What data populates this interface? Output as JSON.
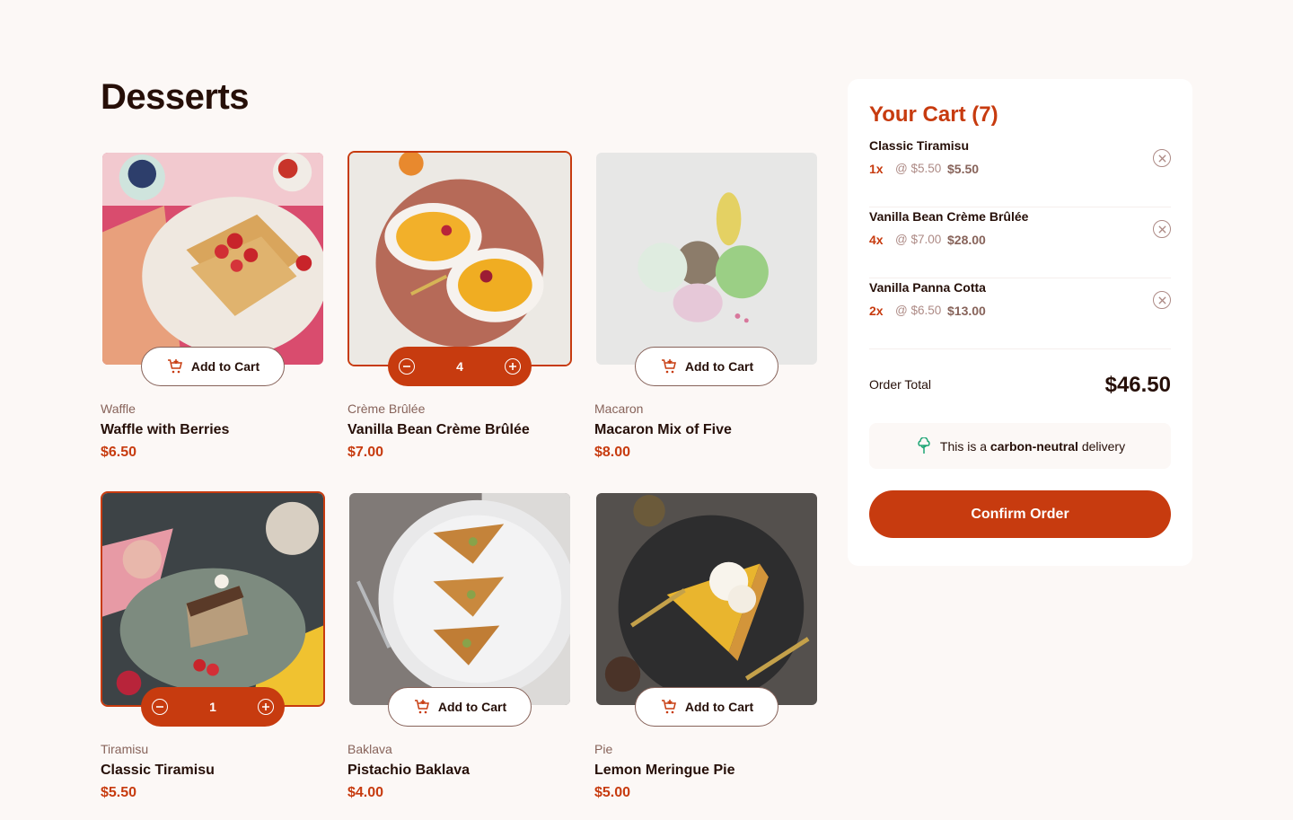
{
  "page": {
    "title": "Desserts"
  },
  "products": [
    {
      "category": "Waffle",
      "name": "Waffle with Berries",
      "price": "$6.50",
      "in_cart": false,
      "add_label": "Add to Cart",
      "image_icon": "waffle-image"
    },
    {
      "category": "Crème Brûlée",
      "name": "Vanilla Bean Crème Brûlée",
      "price": "$7.00",
      "in_cart": true,
      "quantity": "4",
      "image_icon": "creme-brulee-image"
    },
    {
      "category": "Macaron",
      "name": "Macaron Mix of Five",
      "price": "$8.00",
      "in_cart": false,
      "add_label": "Add to Cart",
      "image_icon": "macaron-image"
    },
    {
      "category": "Tiramisu",
      "name": "Classic Tiramisu",
      "price": "$5.50",
      "in_cart": true,
      "quantity": "1",
      "image_icon": "tiramisu-image"
    },
    {
      "category": "Baklava",
      "name": "Pistachio Baklava",
      "price": "$4.00",
      "in_cart": false,
      "add_label": "Add to Cart",
      "image_icon": "baklava-image"
    },
    {
      "category": "Pie",
      "name": "Lemon Meringue Pie",
      "price": "$5.00",
      "in_cart": false,
      "add_label": "Add to Cart",
      "image_icon": "pie-image"
    }
  ],
  "cart": {
    "title": "Your Cart (7)",
    "items": [
      {
        "name": "Classic Tiramisu",
        "qty": "1x",
        "unit": "@ $5.50",
        "total": "$5.50"
      },
      {
        "name": "Vanilla Bean Crème Brûlée",
        "qty": "4x",
        "unit": "@ $7.00",
        "total": "$28.00"
      },
      {
        "name": "Vanilla Panna Cotta",
        "qty": "2x",
        "unit": "@ $6.50",
        "total": "$13.00"
      }
    ],
    "total_label": "Order Total",
    "total_value": "$46.50",
    "carbon_prefix": "This is a ",
    "carbon_bold": "carbon-neutral",
    "carbon_suffix": " delivery",
    "confirm_label": "Confirm Order"
  },
  "colors": {
    "accent": "#c73b0f",
    "text": "#260f08",
    "muted": "#87635a",
    "background": "#fcf8f6"
  }
}
